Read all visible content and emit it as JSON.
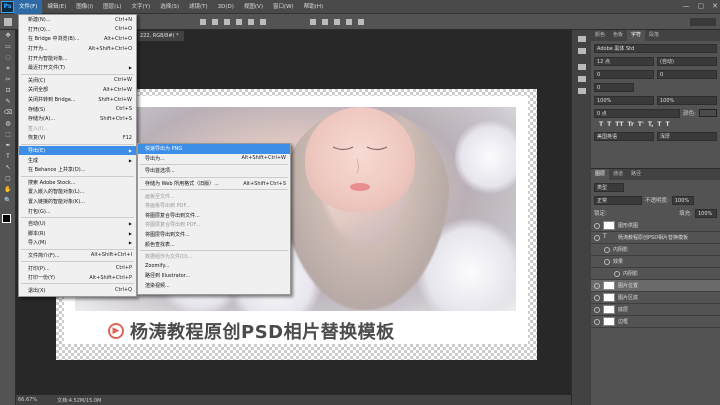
{
  "app": {
    "logo": "Ps"
  },
  "menubar": {
    "items": [
      "文件(F)",
      "编辑(E)",
      "图像(I)",
      "图层(L)",
      "文字(Y)",
      "选择(S)",
      "滤镜(T)",
      "3D(D)",
      "视图(V)",
      "窗口(W)",
      "帮助(H)"
    ],
    "window_controls": [
      "—",
      "▢",
      "✕"
    ]
  },
  "document": {
    "tab_label": "222, RGB/8#) *"
  },
  "file_menu": {
    "items": [
      {
        "label": "新建(N)...",
        "shortcut": "Ctrl+N"
      },
      {
        "label": "打开(O)...",
        "shortcut": "Ctrl+O"
      },
      {
        "label": "在 Bridge 中浏览(B)...",
        "shortcut": "Alt+Ctrl+O"
      },
      {
        "label": "打开为...",
        "shortcut": "Alt+Shift+Ctrl+O"
      },
      {
        "label": "打开为智能对象...",
        "shortcut": ""
      },
      {
        "label": "最近打开文件(T)",
        "shortcut": "",
        "submenu": true
      },
      {
        "sep": true
      },
      {
        "label": "关闭(C)",
        "shortcut": "Ctrl+W"
      },
      {
        "label": "关闭全部",
        "shortcut": "Alt+Ctrl+W"
      },
      {
        "label": "关闭并转到 Bridge...",
        "shortcut": "Shift+Ctrl+W"
      },
      {
        "label": "存储(S)",
        "shortcut": "Ctrl+S"
      },
      {
        "label": "存储为(A)...",
        "shortcut": "Shift+Ctrl+S"
      },
      {
        "label": "签入(I)...",
        "shortcut": "",
        "disabled": true
      },
      {
        "label": "恢复(V)",
        "shortcut": "F12"
      },
      {
        "sep": true
      },
      {
        "label": "导出(E)",
        "shortcut": "",
        "submenu": true,
        "highlight": true
      },
      {
        "label": "生成",
        "shortcut": "",
        "submenu": true
      },
      {
        "label": "在 Behance 上共享(D)...",
        "shortcut": ""
      },
      {
        "sep": true
      },
      {
        "label": "搜索 Adobe Stock...",
        "shortcut": ""
      },
      {
        "label": "置入嵌入的智能对象(L)...",
        "shortcut": ""
      },
      {
        "label": "置入链接的智能对象(K)...",
        "shortcut": ""
      },
      {
        "label": "打包(G)...",
        "shortcut": ""
      },
      {
        "sep": true
      },
      {
        "label": "自动(U)",
        "shortcut": "",
        "submenu": true
      },
      {
        "label": "脚本(R)",
        "shortcut": "",
        "submenu": true
      },
      {
        "label": "导入(M)",
        "shortcut": "",
        "submenu": true
      },
      {
        "sep": true
      },
      {
        "label": "文件简介(F)...",
        "shortcut": "Alt+Shift+Ctrl+I"
      },
      {
        "sep": true
      },
      {
        "label": "打印(P)...",
        "shortcut": "Ctrl+P"
      },
      {
        "label": "打印一份(Y)",
        "shortcut": "Alt+Shift+Ctrl+P"
      },
      {
        "sep": true
      },
      {
        "label": "退出(X)",
        "shortcut": "Ctrl+Q"
      }
    ]
  },
  "export_submenu": {
    "items": [
      {
        "label": "快速导出为 PNG",
        "shortcut": "",
        "highlight": true
      },
      {
        "label": "导出为...",
        "shortcut": "Alt+Shift+Ctrl+W"
      },
      {
        "sep": true
      },
      {
        "label": "导出首选项...",
        "shortcut": ""
      },
      {
        "sep": true
      },
      {
        "label": "存储为 Web 所用格式（旧版）...",
        "shortcut": "Alt+Shift+Ctrl+S"
      },
      {
        "sep": true
      },
      {
        "label": "画板至文件...",
        "shortcut": "",
        "disabled": true
      },
      {
        "label": "将画板导出到 PDF...",
        "shortcut": "",
        "disabled": true
      },
      {
        "label": "将图层复合导出到文件...",
        "shortcut": ""
      },
      {
        "label": "将图层复合导出到 PDF...",
        "shortcut": "",
        "disabled": true
      },
      {
        "label": "将图层导出到文件...",
        "shortcut": ""
      },
      {
        "label": "颜色查找表...",
        "shortcut": ""
      },
      {
        "sep": true
      },
      {
        "label": "数据组作为文件(D)...",
        "shortcut": "",
        "disabled": true
      },
      {
        "label": "Zoomify...",
        "shortcut": ""
      },
      {
        "label": "路径到 Illustrator...",
        "shortcut": ""
      },
      {
        "label": "渲染视频...",
        "shortcut": ""
      }
    ]
  },
  "canvas": {
    "caption": "杨涛教程原创PSD相片替换模板",
    "caption_icon": "▶"
  },
  "statusbar": {
    "zoom": "66.67%",
    "doc_info": "文档:4.52M/15.0M"
  },
  "panels": {
    "tabs": [
      "颜色",
      "色板",
      "字符",
      "段落"
    ],
    "active_tab": "字符",
    "font_family": "Adobe 黑体 Std",
    "font_size": "12 点",
    "leading": "(自动)",
    "kerning": "0",
    "tracking": "0",
    "vscale": "100%",
    "hscale": "100%",
    "baseline": "0 点",
    "color_label": "颜色:",
    "text_styles": [
      "T",
      "T",
      "TT",
      "Tr",
      "T'",
      "T,",
      "T",
      "T"
    ],
    "lang": "美国英语",
    "aa": "浑厚"
  },
  "layers": {
    "tabs": [
      "图层",
      "通道",
      "路径"
    ],
    "kind": "类型",
    "blend": "正常",
    "opacity_label": "不透明度:",
    "opacity": "100%",
    "fill_label": "填充:",
    "fill": "100%",
    "lock_label": "锁定:",
    "items": [
      {
        "name": "图形供图",
        "indent": 0,
        "type": "folder"
      },
      {
        "name": "杨涛教程原创PSD相片替换模板",
        "indent": 0,
        "type": "text"
      },
      {
        "name": "内阴影",
        "indent": 1,
        "type": "fx"
      },
      {
        "name": "效果",
        "indent": 1,
        "type": "fx"
      },
      {
        "name": "内阴影",
        "indent": 2,
        "type": "fx"
      },
      {
        "name": "图片位置",
        "indent": 0,
        "type": "image",
        "selected": true
      },
      {
        "name": "图片区底",
        "indent": 0,
        "type": "image"
      },
      {
        "name": "底层",
        "indent": 0,
        "type": "image"
      },
      {
        "name": "边框",
        "indent": 0,
        "type": "image"
      }
    ]
  }
}
